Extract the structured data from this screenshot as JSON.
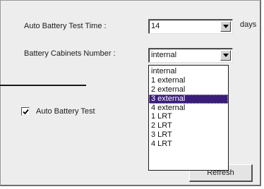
{
  "settings": {
    "test_time_label": "Auto Battery Test Time :",
    "test_time_value": "14",
    "test_time_unit": "days",
    "cabinets_label": "Battery Cabinets Number :",
    "cabinets_value": "internal",
    "auto_test_label": "Auto Battery Test",
    "auto_test_checked": true,
    "refresh_label": "Refresh"
  },
  "dropdown": {
    "selected_index": 3,
    "options": [
      "internal",
      "1 external",
      "2 external",
      "3 external",
      "4 external",
      "1 LRT",
      "2 LRT",
      "3 LRT",
      "4 LRT"
    ]
  },
  "icons": {
    "dropdown_arrow": "chevron-down-icon",
    "checkmark": "check-icon"
  },
  "colors": {
    "panel_background": "#ededed",
    "selection_highlight": "#3a1d7a"
  }
}
